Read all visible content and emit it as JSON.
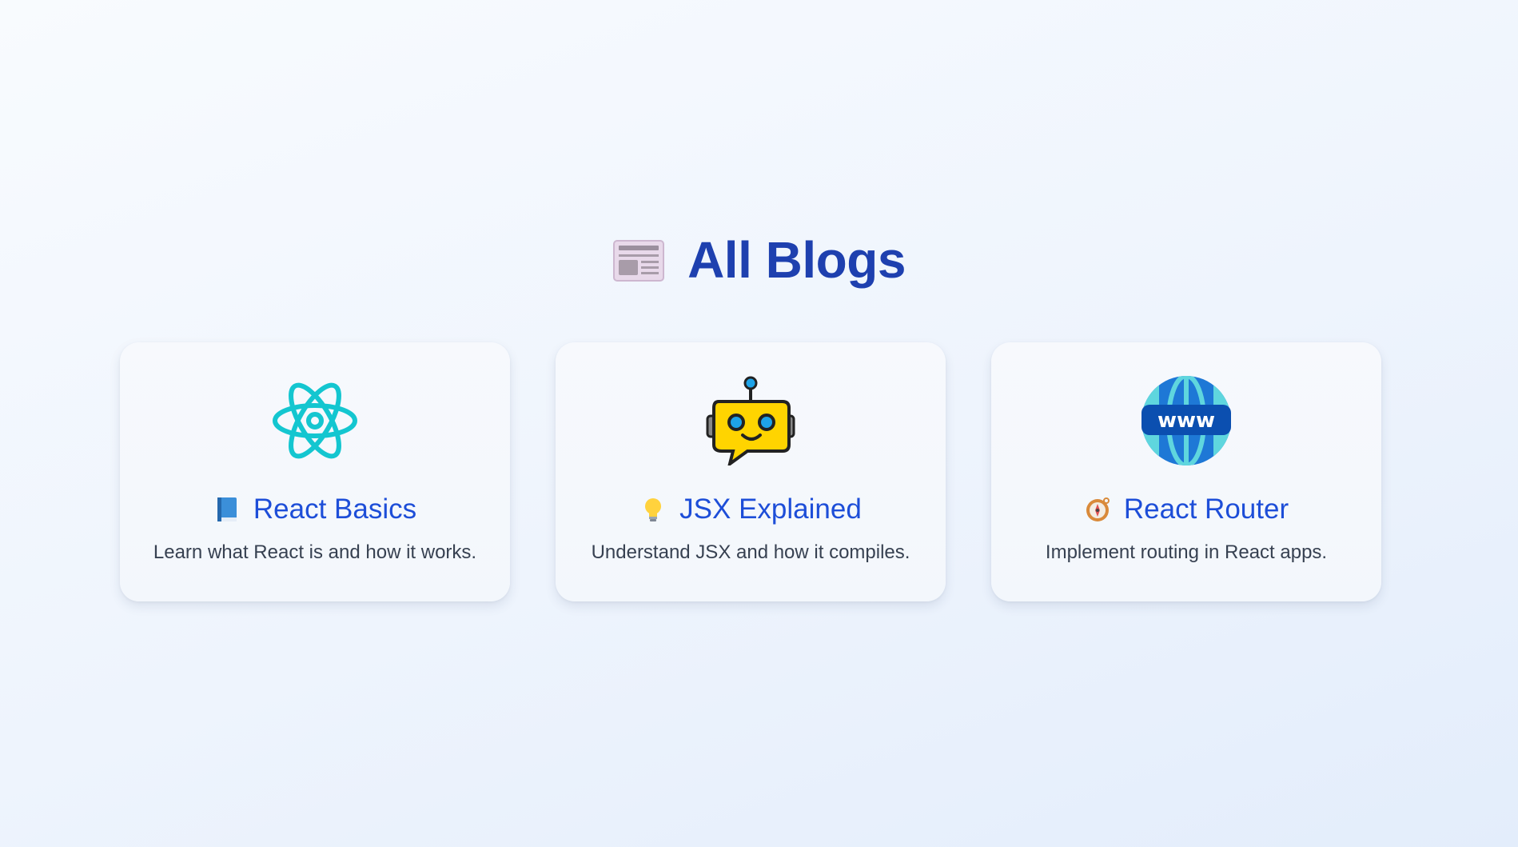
{
  "page": {
    "title": "All Blogs",
    "title_icon": "newspaper-icon",
    "title_color": "#1e40af"
  },
  "blogs": [
    {
      "image_icon": "react-atom-icon",
      "title_emoji": "blue-book-icon",
      "title": "React Basics",
      "description": "Learn what React is and how it works."
    },
    {
      "image_icon": "robot-icon",
      "title_emoji": "light-bulb-icon",
      "title": "JSX Explained",
      "description": "Understand JSX and how it compiles."
    },
    {
      "image_icon": "globe-www-icon",
      "title_emoji": "compass-icon",
      "title": "React Router",
      "description": "Implement routing in React apps."
    }
  ],
  "colors": {
    "card_title": "#1d4ed8",
    "card_text": "#374151"
  }
}
